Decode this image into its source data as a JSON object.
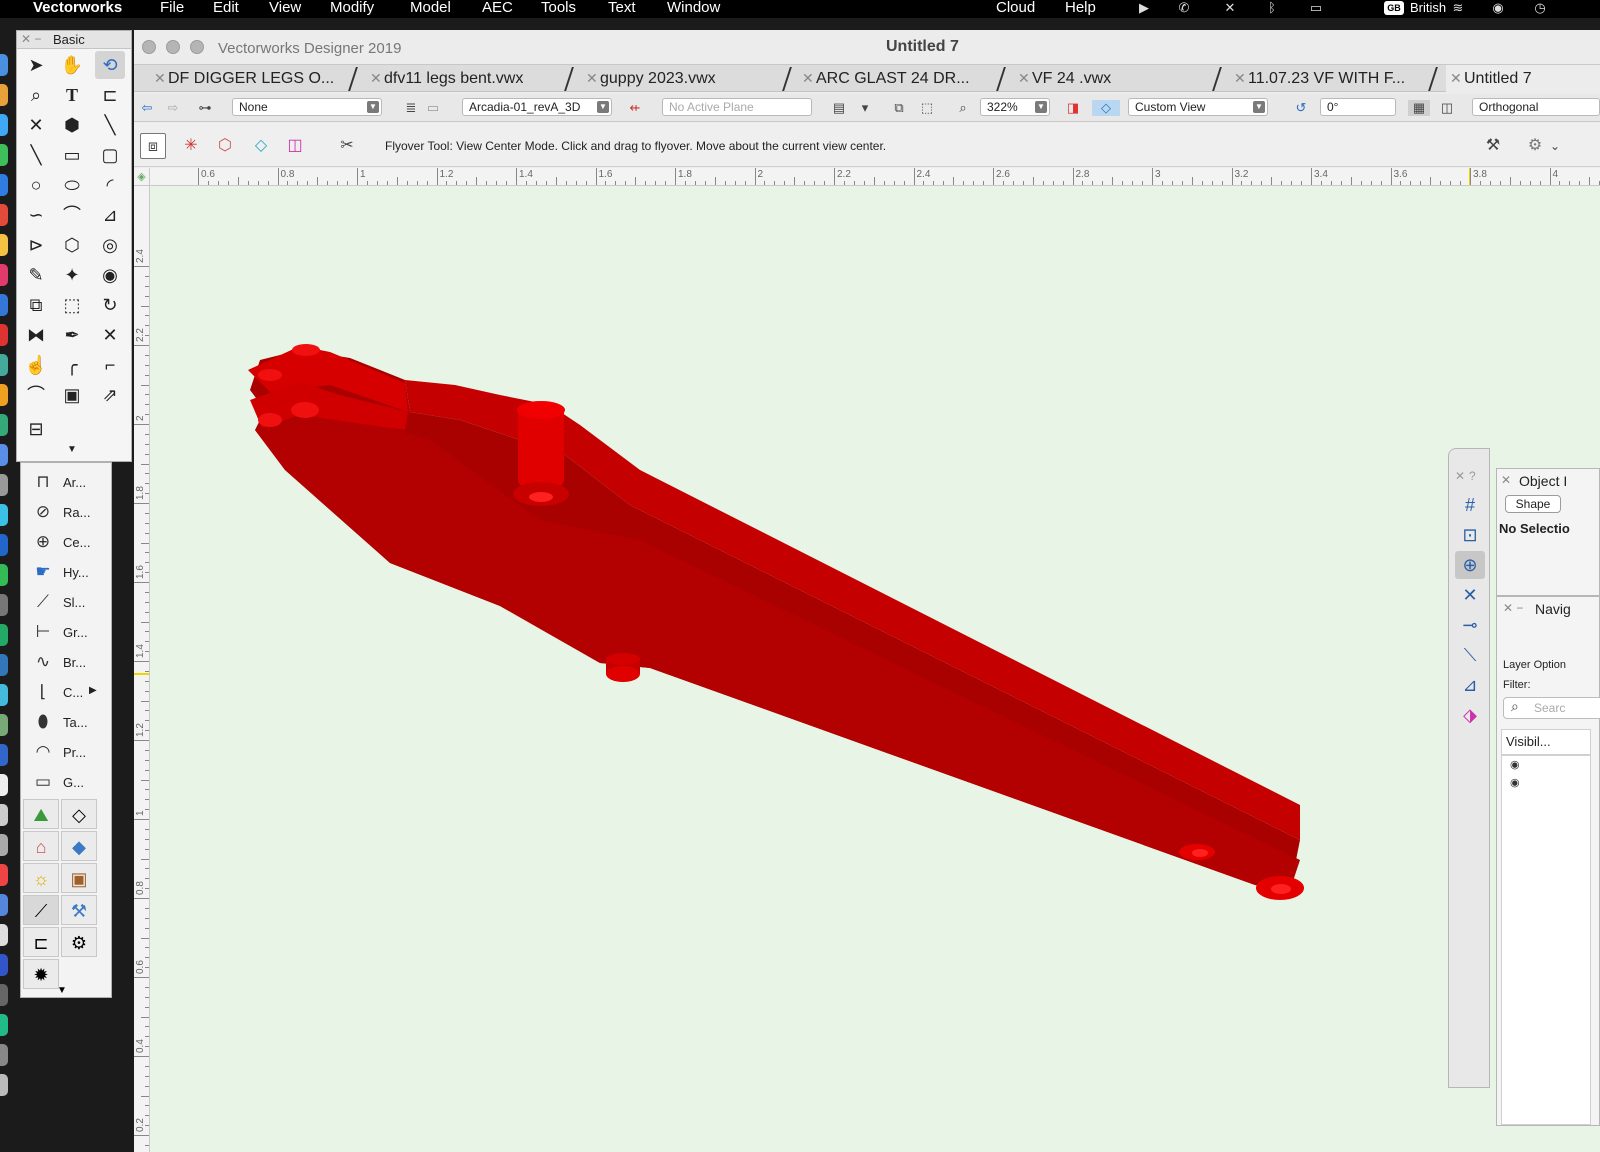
{
  "menubar": {
    "app_name": "Vectorworks",
    "items": [
      "File",
      "Edit",
      "View",
      "Modify",
      "Model",
      "AEC",
      "Tools",
      "Text",
      "Window"
    ],
    "right_items": [
      "Cloud",
      "Help"
    ],
    "input_badge": "GB",
    "input_source": "British"
  },
  "window": {
    "app_title": "Vectorworks Designer 2019",
    "doc_title": "Untitled 7"
  },
  "tabs": [
    {
      "label": "DF DIGGER LEGS O..."
    },
    {
      "label": "dfv11 legs bent.vwx"
    },
    {
      "label": "guppy 2023.vwx"
    },
    {
      "label": "ARC GLAST 24 DR..."
    },
    {
      "label": "VF 24 .vwx"
    },
    {
      "label": "11.07.23 VF WITH F..."
    },
    {
      "label": "Untitled 7"
    }
  ],
  "viewbar": {
    "class_select": "None",
    "layer_select": "Arcadia-01_revA_3D",
    "plane_select": "No Active Plane",
    "zoom": "322%",
    "view_select": "Custom View",
    "angle": "0°",
    "projection": "Orthogonal"
  },
  "modebar": {
    "message": "Flyover Tool: View Center Mode. Click and drag to flyover.  Move about the current view center."
  },
  "rulers": {
    "h_labels": [
      "0.6",
      "0.8",
      "1",
      "1.2",
      "1.4",
      "1.6",
      "1.8",
      "2",
      "2.2",
      "2.4",
      "2.6",
      "2.8",
      "3",
      "3.2",
      "3.4",
      "3.6",
      "3.8",
      "4"
    ],
    "v_labels": [
      "2.4",
      "2.2",
      "2",
      "1.8",
      "1.6",
      "1.4",
      "1.2",
      "1",
      "0.8",
      "0.6",
      "0.4",
      "0.2"
    ]
  },
  "basic_palette": {
    "title": "Basic"
  },
  "toolsets": {
    "items": [
      {
        "label": "Ar...",
        "icon": "arc-dim-icon"
      },
      {
        "label": "Ra...",
        "icon": "radial-dim-icon"
      },
      {
        "label": "Ce...",
        "icon": "center-mark-icon"
      },
      {
        "label": "Hy...",
        "icon": "hyperlink-icon"
      },
      {
        "label": "Sl...",
        "icon": "slope-icon"
      },
      {
        "label": "Gr...",
        "icon": "grid-axis-icon"
      },
      {
        "label": "Br...",
        "icon": "break-line-icon"
      },
      {
        "label": "C...",
        "icon": "callout-icon"
      },
      {
        "label": "Ta...",
        "icon": "tag-icon"
      },
      {
        "label": "Pr...",
        "icon": "protractor-icon"
      },
      {
        "label": "G...",
        "icon": "general-note-icon"
      }
    ]
  },
  "object_info": {
    "title": "Object I",
    "tab_shape": "Shape",
    "no_selection": "No Selectio"
  },
  "navigation": {
    "title": "Navig",
    "layer_options": "Layer Option",
    "filter": "Filter:",
    "search_placeholder": "Searc",
    "col_visibility": "Visibil..."
  },
  "colors": {
    "model_red": "#d10000",
    "canvas_bg": "#e8f4e6"
  }
}
